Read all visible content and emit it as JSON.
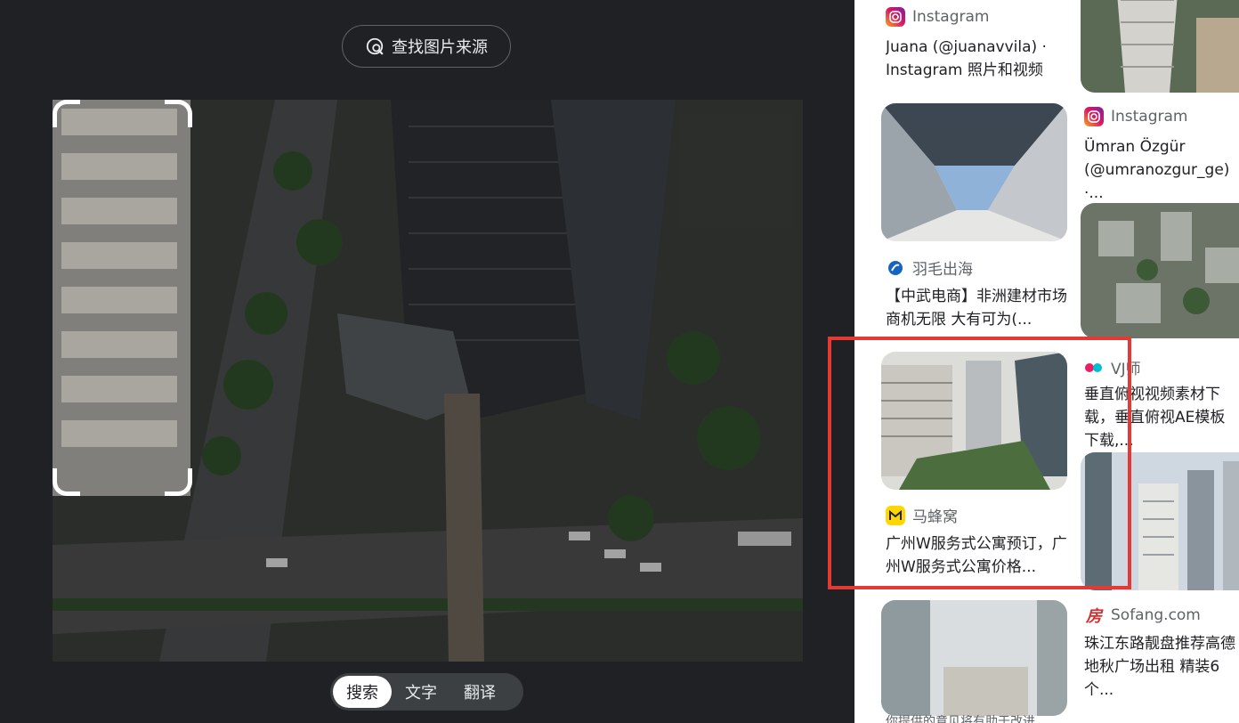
{
  "find_source": {
    "label": "查找图片来源",
    "icon": "lens-search-icon"
  },
  "mode_tabs": [
    {
      "label": "搜索",
      "active": true
    },
    {
      "label": "文字",
      "active": false
    },
    {
      "label": "翻译",
      "active": false
    }
  ],
  "results": [
    {
      "source": "Instagram",
      "source_icon": "instagram-icon",
      "title": "Juana (@juanavvila) · Instagram 照片和视频"
    },
    {
      "source": "Instagram",
      "source_icon": "instagram-icon",
      "title": "Ümran Özgür (@umranozgur_ge) ·..."
    },
    {
      "source": "羽毛出海",
      "source_icon": "yumao-icon",
      "title": "【中武电商】非洲建材市场商机无限 大有可为(..."
    },
    {
      "source": "VJ师",
      "source_icon": "vjshi-icon",
      "title": "垂直俯视视频素材下载，垂直俯视AE模板下载,..."
    },
    {
      "source": "马蜂窝",
      "source_icon": "mafengwo-icon",
      "title": "广州W服务式公寓预订，广州W服务式公寓价格..."
    },
    {
      "source": "Sofang.com",
      "source_icon": "sofang-icon",
      "title": "珠江东路靓盘推荐高德地秋广场出租 精装6个..."
    }
  ],
  "bottom_note": "你提供的意见将有助于改进..."
}
